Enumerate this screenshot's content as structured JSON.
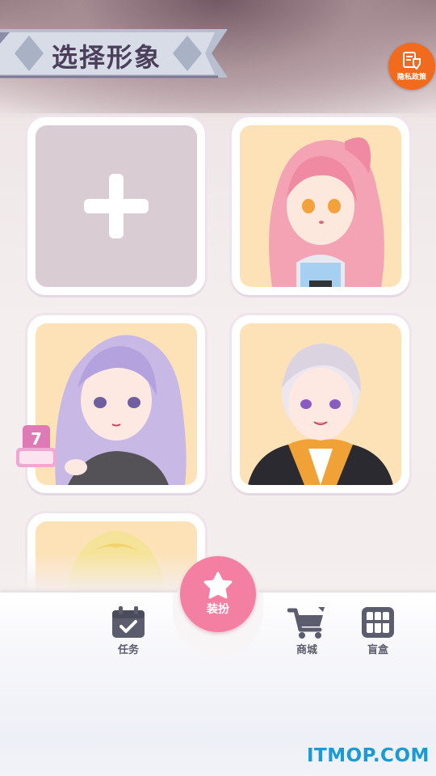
{
  "header": {
    "title": "选择形象",
    "privacy_label": "隐私政策",
    "privacy_icon": "shield-doc-icon"
  },
  "cards": {
    "add_icon": "plus-icon",
    "items": [
      {
        "name": "pink-hair-girl",
        "hair": "#f4a3b5"
      },
      {
        "name": "lavender-hair-girl",
        "hair": "#c7b8e6"
      },
      {
        "name": "silver-hair-boy",
        "hair": "#ece6ee"
      },
      {
        "name": "blonde-hair-character",
        "hair": "#f6e39a"
      }
    ],
    "badge_number": "7"
  },
  "nav": {
    "tasks_label": "任务",
    "dressup_label": "装扮",
    "shop_label": "商城",
    "blindbox_label": "盲盒"
  },
  "watermark": "ITMOP.COM",
  "colors": {
    "accent_pink": "#f37fa2",
    "badge_orange": "#f26b1d",
    "nav_icon": "#5b5d6e",
    "card_bg": "#fde2b8"
  }
}
